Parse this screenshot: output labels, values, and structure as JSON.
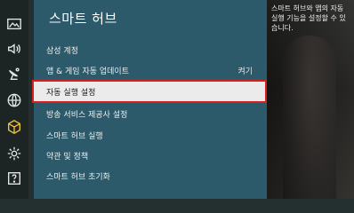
{
  "panel": {
    "title": "스마트 허브",
    "items": [
      {
        "label": "삼성 계정",
        "value": ""
      },
      {
        "label": "앱 & 게임 자동 업데이트",
        "value": "켜기"
      },
      {
        "label": "자동 실행 설정",
        "value": ""
      },
      {
        "label": "방송 서비스 제공사 설정",
        "value": ""
      },
      {
        "label": "스마트 허브 실행",
        "value": ""
      },
      {
        "label": "약관 및 정책",
        "value": ""
      },
      {
        "label": "스마트 허브 초기화",
        "value": ""
      }
    ],
    "selected_index": 2
  },
  "description": "스마트 허브와 앱의 자동 실행 기능을 설정할 수 있습니다.",
  "sidebar": {
    "icons": [
      "picture-icon",
      "sound-icon",
      "broadcast-icon",
      "network-icon",
      "smart-hub-icon",
      "system-icon",
      "support-icon"
    ],
    "active_index": 4
  },
  "colors": {
    "panel": "#2c5a6a",
    "selection_border": "#d8201f",
    "active_icon": "#f0c23a"
  }
}
